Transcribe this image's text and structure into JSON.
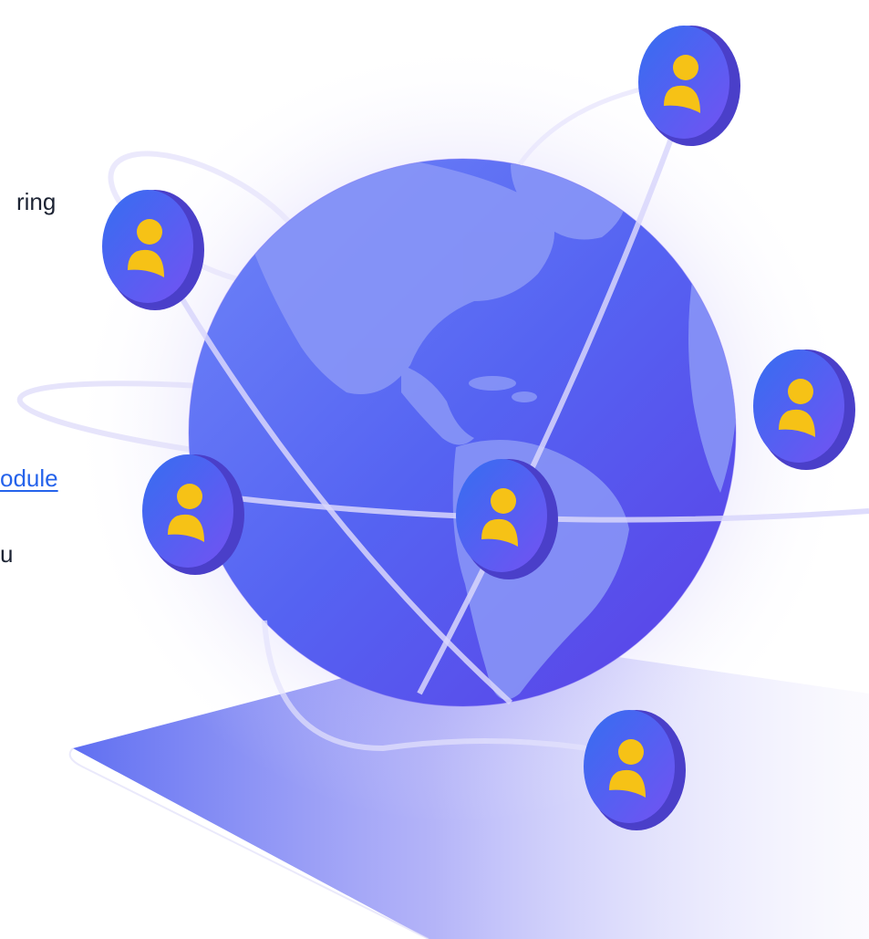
{
  "text_fragments": {
    "line_1": "ring",
    "link": "odule",
    "line_3": "u"
  },
  "colors": {
    "globe_light": "#6e7ff7",
    "globe_dark": "#4a3ee8",
    "land": "#8f9cf7",
    "badge_blue": "#3b6af0",
    "badge_violet": "#6b55f2",
    "badge_rim": "#4a3fc9",
    "person": "#f6c216",
    "link_blue": "#2563eb",
    "text_dark": "#1c2333"
  },
  "icons": {
    "user_badge": "user-avatar-icon",
    "globe": "globe-illustration"
  }
}
